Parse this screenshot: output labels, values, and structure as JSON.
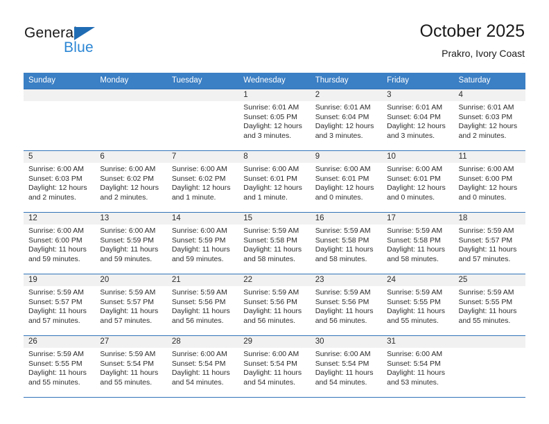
{
  "logo": {
    "text_primary": "General",
    "text_secondary": "Blue",
    "triangle_color": "#1f6cb4",
    "secondary_color": "#2b86d4"
  },
  "header": {
    "title": "October 2025",
    "subtitle": "Prakro, Ivory Coast"
  },
  "theme": {
    "header_bg": "#3b7fc4",
    "row_rule": "#2f72b8",
    "daynum_band": "#f1f1f1"
  },
  "weekdays": [
    "Sunday",
    "Monday",
    "Tuesday",
    "Wednesday",
    "Thursday",
    "Friday",
    "Saturday"
  ],
  "weeks": [
    [
      {
        "day": "",
        "sunrise": "",
        "sunset": "",
        "daylight": ""
      },
      {
        "day": "",
        "sunrise": "",
        "sunset": "",
        "daylight": ""
      },
      {
        "day": "",
        "sunrise": "",
        "sunset": "",
        "daylight": ""
      },
      {
        "day": "1",
        "sunrise": "Sunrise: 6:01 AM",
        "sunset": "Sunset: 6:05 PM",
        "daylight": "Daylight: 12 hours and 3 minutes."
      },
      {
        "day": "2",
        "sunrise": "Sunrise: 6:01 AM",
        "sunset": "Sunset: 6:04 PM",
        "daylight": "Daylight: 12 hours and 3 minutes."
      },
      {
        "day": "3",
        "sunrise": "Sunrise: 6:01 AM",
        "sunset": "Sunset: 6:04 PM",
        "daylight": "Daylight: 12 hours and 3 minutes."
      },
      {
        "day": "4",
        "sunrise": "Sunrise: 6:01 AM",
        "sunset": "Sunset: 6:03 PM",
        "daylight": "Daylight: 12 hours and 2 minutes."
      }
    ],
    [
      {
        "day": "5",
        "sunrise": "Sunrise: 6:00 AM",
        "sunset": "Sunset: 6:03 PM",
        "daylight": "Daylight: 12 hours and 2 minutes."
      },
      {
        "day": "6",
        "sunrise": "Sunrise: 6:00 AM",
        "sunset": "Sunset: 6:02 PM",
        "daylight": "Daylight: 12 hours and 2 minutes."
      },
      {
        "day": "7",
        "sunrise": "Sunrise: 6:00 AM",
        "sunset": "Sunset: 6:02 PM",
        "daylight": "Daylight: 12 hours and 1 minute."
      },
      {
        "day": "8",
        "sunrise": "Sunrise: 6:00 AM",
        "sunset": "Sunset: 6:01 PM",
        "daylight": "Daylight: 12 hours and 1 minute."
      },
      {
        "day": "9",
        "sunrise": "Sunrise: 6:00 AM",
        "sunset": "Sunset: 6:01 PM",
        "daylight": "Daylight: 12 hours and 0 minutes."
      },
      {
        "day": "10",
        "sunrise": "Sunrise: 6:00 AM",
        "sunset": "Sunset: 6:01 PM",
        "daylight": "Daylight: 12 hours and 0 minutes."
      },
      {
        "day": "11",
        "sunrise": "Sunrise: 6:00 AM",
        "sunset": "Sunset: 6:00 PM",
        "daylight": "Daylight: 12 hours and 0 minutes."
      }
    ],
    [
      {
        "day": "12",
        "sunrise": "Sunrise: 6:00 AM",
        "sunset": "Sunset: 6:00 PM",
        "daylight": "Daylight: 11 hours and 59 minutes."
      },
      {
        "day": "13",
        "sunrise": "Sunrise: 6:00 AM",
        "sunset": "Sunset: 5:59 PM",
        "daylight": "Daylight: 11 hours and 59 minutes."
      },
      {
        "day": "14",
        "sunrise": "Sunrise: 6:00 AM",
        "sunset": "Sunset: 5:59 PM",
        "daylight": "Daylight: 11 hours and 59 minutes."
      },
      {
        "day": "15",
        "sunrise": "Sunrise: 5:59 AM",
        "sunset": "Sunset: 5:58 PM",
        "daylight": "Daylight: 11 hours and 58 minutes."
      },
      {
        "day": "16",
        "sunrise": "Sunrise: 5:59 AM",
        "sunset": "Sunset: 5:58 PM",
        "daylight": "Daylight: 11 hours and 58 minutes."
      },
      {
        "day": "17",
        "sunrise": "Sunrise: 5:59 AM",
        "sunset": "Sunset: 5:58 PM",
        "daylight": "Daylight: 11 hours and 58 minutes."
      },
      {
        "day": "18",
        "sunrise": "Sunrise: 5:59 AM",
        "sunset": "Sunset: 5:57 PM",
        "daylight": "Daylight: 11 hours and 57 minutes."
      }
    ],
    [
      {
        "day": "19",
        "sunrise": "Sunrise: 5:59 AM",
        "sunset": "Sunset: 5:57 PM",
        "daylight": "Daylight: 11 hours and 57 minutes."
      },
      {
        "day": "20",
        "sunrise": "Sunrise: 5:59 AM",
        "sunset": "Sunset: 5:57 PM",
        "daylight": "Daylight: 11 hours and 57 minutes."
      },
      {
        "day": "21",
        "sunrise": "Sunrise: 5:59 AM",
        "sunset": "Sunset: 5:56 PM",
        "daylight": "Daylight: 11 hours and 56 minutes."
      },
      {
        "day": "22",
        "sunrise": "Sunrise: 5:59 AM",
        "sunset": "Sunset: 5:56 PM",
        "daylight": "Daylight: 11 hours and 56 minutes."
      },
      {
        "day": "23",
        "sunrise": "Sunrise: 5:59 AM",
        "sunset": "Sunset: 5:56 PM",
        "daylight": "Daylight: 11 hours and 56 minutes."
      },
      {
        "day": "24",
        "sunrise": "Sunrise: 5:59 AM",
        "sunset": "Sunset: 5:55 PM",
        "daylight": "Daylight: 11 hours and 55 minutes."
      },
      {
        "day": "25",
        "sunrise": "Sunrise: 5:59 AM",
        "sunset": "Sunset: 5:55 PM",
        "daylight": "Daylight: 11 hours and 55 minutes."
      }
    ],
    [
      {
        "day": "26",
        "sunrise": "Sunrise: 5:59 AM",
        "sunset": "Sunset: 5:55 PM",
        "daylight": "Daylight: 11 hours and 55 minutes."
      },
      {
        "day": "27",
        "sunrise": "Sunrise: 5:59 AM",
        "sunset": "Sunset: 5:54 PM",
        "daylight": "Daylight: 11 hours and 55 minutes."
      },
      {
        "day": "28",
        "sunrise": "Sunrise: 6:00 AM",
        "sunset": "Sunset: 5:54 PM",
        "daylight": "Daylight: 11 hours and 54 minutes."
      },
      {
        "day": "29",
        "sunrise": "Sunrise: 6:00 AM",
        "sunset": "Sunset: 5:54 PM",
        "daylight": "Daylight: 11 hours and 54 minutes."
      },
      {
        "day": "30",
        "sunrise": "Sunrise: 6:00 AM",
        "sunset": "Sunset: 5:54 PM",
        "daylight": "Daylight: 11 hours and 54 minutes."
      },
      {
        "day": "31",
        "sunrise": "Sunrise: 6:00 AM",
        "sunset": "Sunset: 5:54 PM",
        "daylight": "Daylight: 11 hours and 53 minutes."
      },
      {
        "day": "",
        "sunrise": "",
        "sunset": "",
        "daylight": ""
      }
    ]
  ]
}
